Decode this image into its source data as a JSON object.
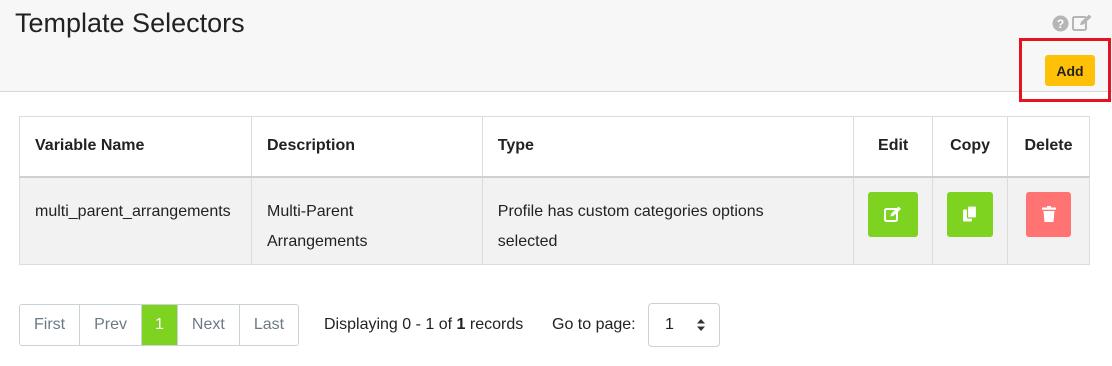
{
  "header": {
    "title": "Template Selectors",
    "add_label": "Add",
    "icons": [
      "help-icon",
      "edit-icon"
    ]
  },
  "table": {
    "columns": [
      "Variable Name",
      "Description",
      "Type",
      "Edit",
      "Copy",
      "Delete"
    ],
    "rows": [
      {
        "variable_name": "multi_parent_arrangements",
        "description_line1": "Multi-Parent",
        "description_line2": "Arrangements",
        "type_line1": "Profile has custom categories options",
        "type_line2": "selected"
      }
    ]
  },
  "pagination": {
    "first": "First",
    "prev": "Prev",
    "current": "1",
    "next": "Next",
    "last": "Last"
  },
  "records": {
    "prefix": "Displaying 0 - 1 of",
    "count": "1",
    "suffix": "records"
  },
  "goto": {
    "label": "Go to page:",
    "selected": "1"
  },
  "colors": {
    "accent_green": "#7ed321",
    "add_yellow": "#ffc107",
    "delete_red": "#ff7373",
    "highlight_red": "#e3131f"
  }
}
